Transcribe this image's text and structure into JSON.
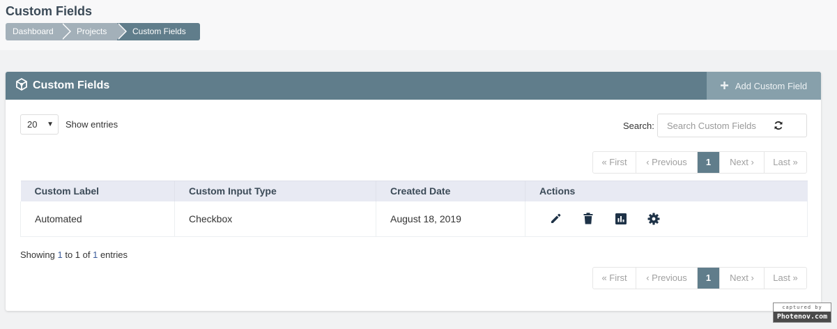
{
  "header": {
    "title": "Custom Fields",
    "breadcrumb": [
      "Dashboard",
      "Projects",
      "Custom Fields"
    ]
  },
  "panel": {
    "title": "Custom Fields",
    "add_button_label": "Add Custom Field",
    "entries_value": "20",
    "show_entries_label": "Show entries",
    "search_label": "Search:",
    "search_placeholder": "Search Custom Fields",
    "pagination": {
      "first": "« First",
      "previous": "‹ Previous",
      "current": "1",
      "next": "Next ›",
      "last": "Last »"
    },
    "table": {
      "columns": [
        "Custom Label",
        "Custom Input Type",
        "Created Date",
        "Actions"
      ],
      "rows": [
        {
          "label": "Automated",
          "input_type": "Checkbox",
          "created": "August 18, 2019",
          "actions": [
            "pencil-icon",
            "trash-icon",
            "chart-icon",
            "gear-icon"
          ]
        }
      ]
    },
    "summary": {
      "prefix": "Showing ",
      "from": "1",
      "to_word": " to ",
      "to": "1",
      "of_word": " of ",
      "total": "1",
      "suffix": " entries"
    }
  },
  "watermark": {
    "small": "captured by",
    "big": "Photenov.com"
  },
  "colors": {
    "accent": "#607d8b",
    "accent_light": "#87a0ab",
    "breadcrumb_inactive": "#a3b0b9",
    "table_header_bg": "#e8eaf3",
    "icon_color": "#1e3247"
  }
}
